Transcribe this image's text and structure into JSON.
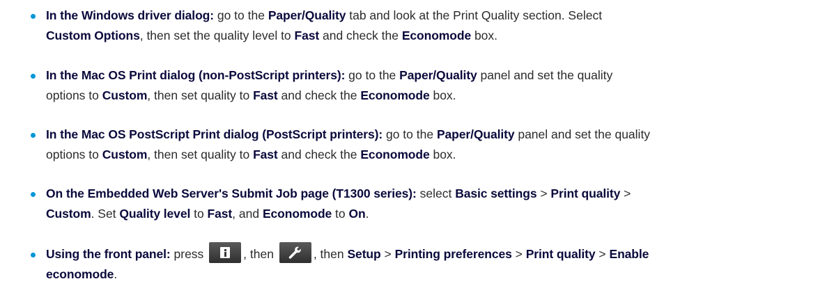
{
  "items": [
    {
      "lines": [
        [
          {
            "t": "In the Windows driver dialog:",
            "s": "lead"
          },
          {
            "t": " go to the ",
            "s": "plain"
          },
          {
            "t": "Paper/Quality",
            "s": "em"
          },
          {
            "t": " tab and look at the Print Quality section. Select",
            "s": "plain"
          }
        ],
        [
          {
            "t": "Custom Options",
            "s": "em"
          },
          {
            "t": ", then set the quality level to ",
            "s": "plain"
          },
          {
            "t": "Fast",
            "s": "em"
          },
          {
            "t": " and check the ",
            "s": "plain"
          },
          {
            "t": "Economode",
            "s": "em"
          },
          {
            "t": " box.",
            "s": "plain"
          }
        ]
      ]
    },
    {
      "lines": [
        [
          {
            "t": "In the Mac OS Print dialog (non-PostScript printers):",
            "s": "lead"
          },
          {
            "t": " go to the ",
            "s": "plain"
          },
          {
            "t": "Paper/Quality",
            "s": "em"
          },
          {
            "t": " panel and set the quality",
            "s": "plain"
          }
        ],
        [
          {
            "t": "options to ",
            "s": "plain"
          },
          {
            "t": "Custom",
            "s": "em"
          },
          {
            "t": ", then set quality to ",
            "s": "plain"
          },
          {
            "t": "Fast",
            "s": "em"
          },
          {
            "t": " and check the ",
            "s": "plain"
          },
          {
            "t": "Economode",
            "s": "em"
          },
          {
            "t": " box.",
            "s": "plain"
          }
        ]
      ]
    },
    {
      "lines": [
        [
          {
            "t": "In the Mac OS PostScript Print dialog (PostScript printers):",
            "s": "lead"
          },
          {
            "t": " go to the ",
            "s": "plain"
          },
          {
            "t": "Paper/Quality",
            "s": "em"
          },
          {
            "t": " panel and set the quality",
            "s": "plain"
          }
        ],
        [
          {
            "t": "options to ",
            "s": "plain"
          },
          {
            "t": "Custom",
            "s": "em"
          },
          {
            "t": ", then set quality to ",
            "s": "plain"
          },
          {
            "t": "Fast",
            "s": "em"
          },
          {
            "t": " and check the ",
            "s": "plain"
          },
          {
            "t": "Economode",
            "s": "em"
          },
          {
            "t": " box.",
            "s": "plain"
          }
        ]
      ]
    },
    {
      "lines": [
        [
          {
            "t": "On the Embedded Web Server's Submit Job page (T1300 series):",
            "s": "lead"
          },
          {
            "t": " select ",
            "s": "plain"
          },
          {
            "t": "Basic settings",
            "s": "em"
          },
          {
            "t": " > ",
            "s": "plain"
          },
          {
            "t": "Print quality",
            "s": "em"
          },
          {
            "t": " >",
            "s": "plain"
          }
        ],
        [
          {
            "t": "Custom",
            "s": "em"
          },
          {
            "t": ". Set ",
            "s": "plain"
          },
          {
            "t": "Quality level",
            "s": "em"
          },
          {
            "t": " to ",
            "s": "plain"
          },
          {
            "t": "Fast",
            "s": "em"
          },
          {
            "t": ", and ",
            "s": "plain"
          },
          {
            "t": "Economode",
            "s": "em"
          },
          {
            "t": " to ",
            "s": "plain"
          },
          {
            "t": "On",
            "s": "em"
          },
          {
            "t": ".",
            "s": "plain"
          }
        ]
      ]
    },
    {
      "lines": [
        [
          {
            "t": "Using the front panel:",
            "s": "lead"
          },
          {
            "t": " press ",
            "s": "plain"
          },
          {
            "icon": "info-button-icon"
          },
          {
            "t": ", then ",
            "s": "plain"
          },
          {
            "icon": "wrench-button-icon"
          },
          {
            "t": ", then ",
            "s": "plain"
          },
          {
            "t": "Setup",
            "s": "em"
          },
          {
            "t": " > ",
            "s": "plain"
          },
          {
            "t": "Printing preferences",
            "s": "em"
          },
          {
            "t": " > ",
            "s": "plain"
          },
          {
            "t": "Print quality",
            "s": "em"
          },
          {
            "t": " > ",
            "s": "plain"
          },
          {
            "t": "Enable",
            "s": "em"
          }
        ],
        [
          {
            "t": "economode",
            "s": "em"
          },
          {
            "t": ".",
            "s": "plain"
          }
        ]
      ]
    }
  ],
  "colors": {
    "bullet": "#0096d6",
    "emphasis": "#0a0a3c",
    "body_text": "#2b2b2b"
  }
}
